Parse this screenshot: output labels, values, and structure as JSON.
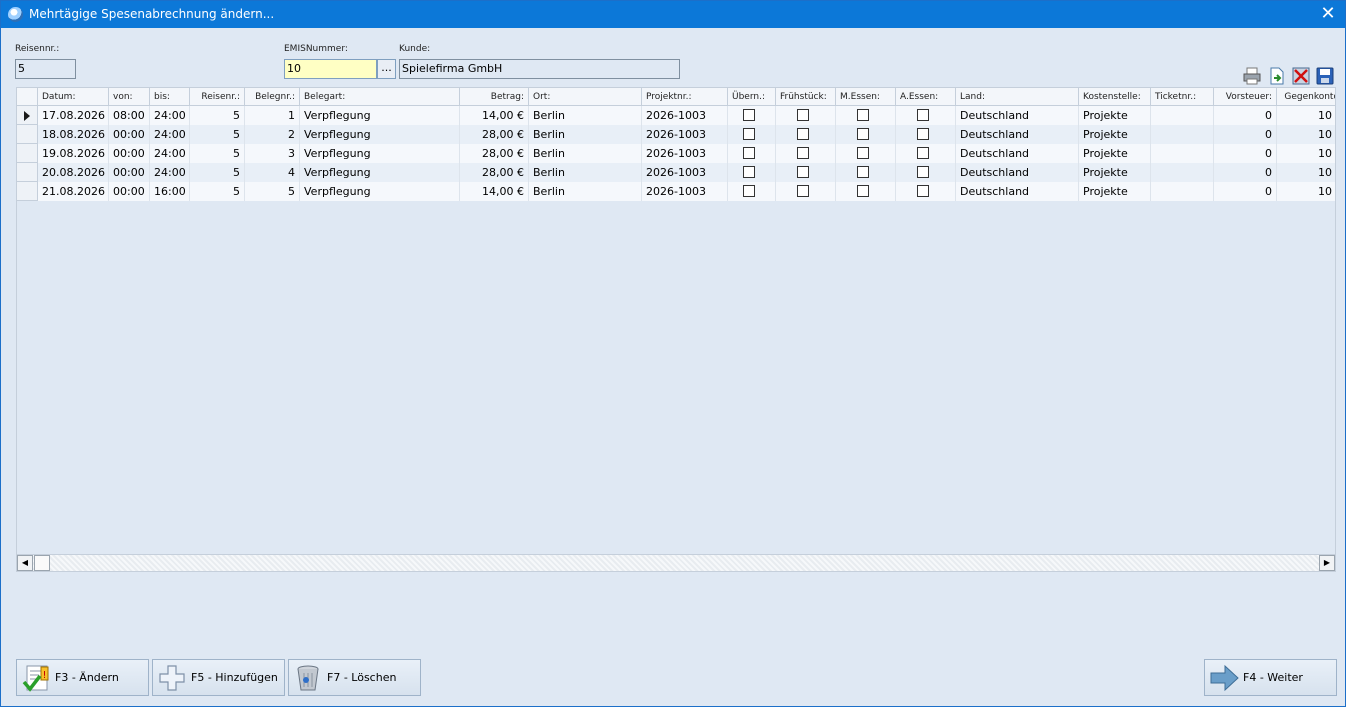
{
  "window": {
    "title": "Mehrtägige Spesenabrechnung ändern...",
    "close_glyph": "✕"
  },
  "form": {
    "reisenr_label": "Reisennr.:",
    "reisenr_value": "5",
    "emis_label": "EMISNummer:",
    "emis_value": "10",
    "emis_button": "...",
    "kunde_label": "Kunde:",
    "kunde_value": "Spielefirma GmbH"
  },
  "toolbar_icons": [
    "printer-icon",
    "export-icon",
    "delete-icon",
    "save-icon"
  ],
  "table": {
    "columns": [
      "Datum:",
      "von:",
      "bis:",
      "Reisenr.:",
      "Belegnr.:",
      "Belegart:",
      "Betrag:",
      "Ort:",
      "Projektnr.:",
      "Übern.:",
      "Frühstück:",
      "M.Essen:",
      "A.Essen:",
      "Land:",
      "Kostenstelle:",
      "Ticketnr.:",
      "Vorsteuer:",
      "Gegenkonto:"
    ],
    "rows": [
      {
        "datum": "17.08.2026",
        "von": "08:00",
        "bis": "24:00",
        "reisenr": "5",
        "belegnr": "1",
        "belegart": "Verpflegung",
        "betrag": "14,00 €",
        "ort": "Berlin",
        "projektnr": "2026-1003",
        "land": "Deutschland",
        "kostenstelle": "Projekte",
        "ticketnr": "",
        "vorsteuer": "0",
        "gegenkonto": "10"
      },
      {
        "datum": "18.08.2026",
        "von": "00:00",
        "bis": "24:00",
        "reisenr": "5",
        "belegnr": "2",
        "belegart": "Verpflegung",
        "betrag": "28,00 €",
        "ort": "Berlin",
        "projektnr": "2026-1003",
        "land": "Deutschland",
        "kostenstelle": "Projekte",
        "ticketnr": "",
        "vorsteuer": "0",
        "gegenkonto": "10"
      },
      {
        "datum": "19.08.2026",
        "von": "00:00",
        "bis": "24:00",
        "reisenr": "5",
        "belegnr": "3",
        "belegart": "Verpflegung",
        "betrag": "28,00 €",
        "ort": "Berlin",
        "projektnr": "2026-1003",
        "land": "Deutschland",
        "kostenstelle": "Projekte",
        "ticketnr": "",
        "vorsteuer": "0",
        "gegenkonto": "10"
      },
      {
        "datum": "20.08.2026",
        "von": "00:00",
        "bis": "24:00",
        "reisenr": "5",
        "belegnr": "4",
        "belegart": "Verpflegung",
        "betrag": "28,00 €",
        "ort": "Berlin",
        "projektnr": "2026-1003",
        "land": "Deutschland",
        "kostenstelle": "Projekte",
        "ticketnr": "",
        "vorsteuer": "0",
        "gegenkonto": "10"
      },
      {
        "datum": "21.08.2026",
        "von": "00:00",
        "bis": "16:00",
        "reisenr": "5",
        "belegnr": "5",
        "belegart": "Verpflegung",
        "betrag": "14,00 €",
        "ort": "Berlin",
        "projektnr": "2026-1003",
        "land": "Deutschland",
        "kostenstelle": "Projekte",
        "ticketnr": "",
        "vorsteuer": "0",
        "gegenkonto": "10"
      }
    ]
  },
  "buttons": {
    "aendern": "F3 - Ändern",
    "hinzufuegen": "F5 - Hinzufügen",
    "loeschen": "F7 - Löschen",
    "weiter": "F4 - Weiter"
  },
  "colors": {
    "titlebar": "#0c78d8",
    "background": "#dfe8f3",
    "input_highlight": "#ffffc4"
  }
}
